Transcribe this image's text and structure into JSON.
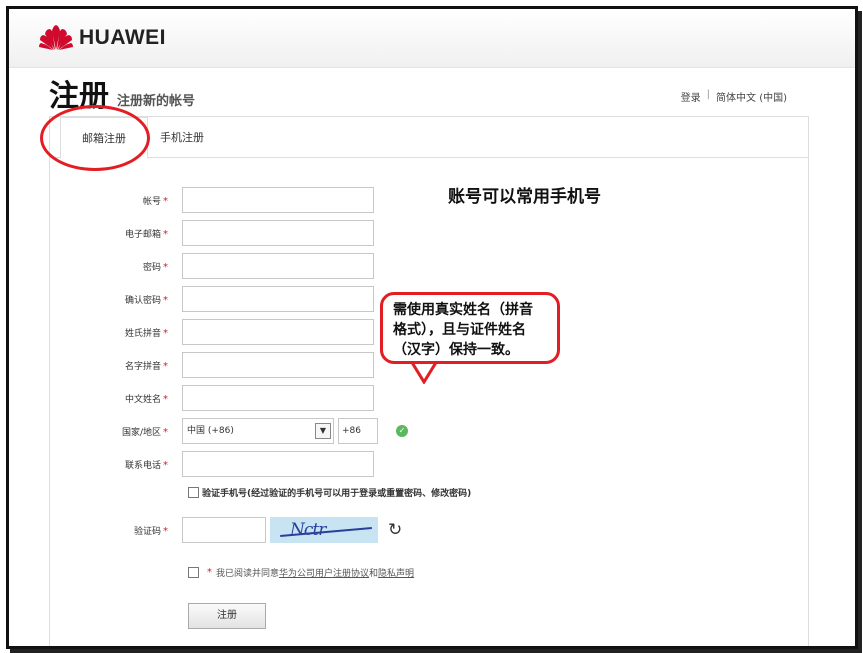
{
  "header": {
    "brand": "HUAWEI",
    "brand_color": "#cf0a2c"
  },
  "page": {
    "title": "注册",
    "subtitle": "注册新的帐号"
  },
  "top_links": {
    "login": "登录",
    "separator": "|",
    "language": "简体中文 (中国)"
  },
  "tabs": [
    {
      "label": "邮箱注册",
      "active": true
    },
    {
      "label": "手机注册",
      "active": false
    }
  ],
  "form": {
    "required_mark": "*",
    "account_label": "帐号",
    "email_label": "电子邮箱",
    "password_label": "密码",
    "confirm_password_label": "确认密码",
    "surname_pinyin_label": "姓氏拼音",
    "givenname_pinyin_label": "名字拼音",
    "chinese_name_label": "中文姓名",
    "country_label": "国家/地区",
    "country_value": "中国 (+86)",
    "country_code": "+86",
    "phone_label": "联系电话",
    "verify_phone_text": "验证手机号(经过验证的手机号可以用于登录或重置密码、修改密码)",
    "captcha_label": "验证码",
    "captcha_text": "Nctr",
    "agree_prefix": "我已阅读并同意",
    "agree_link1": "华为公司用户注册协议",
    "agree_and": "和",
    "agree_link2": "隐私声明",
    "submit_label": "注册"
  },
  "annotations": {
    "phone_note": "账号可以常用手机号",
    "name_note_line1": "需使用真实姓名（拼音",
    "name_note_line2": "格式），且与证件姓名",
    "name_note_line3": "（汉字）保持一致。",
    "highlight_color": "#e21d24"
  }
}
